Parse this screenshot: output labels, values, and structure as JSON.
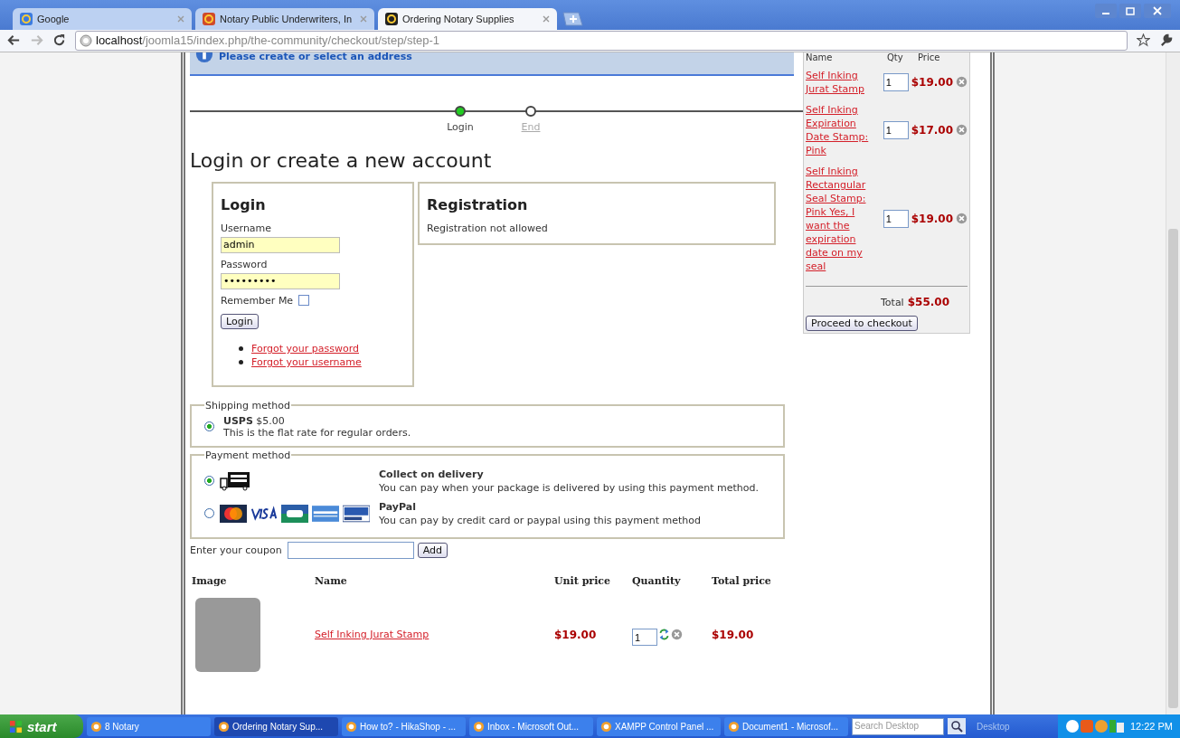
{
  "browser": {
    "tabs": [
      {
        "title": "Google",
        "selected": false,
        "kind": "google"
      },
      {
        "title": "Notary Public Underwriters, In",
        "selected": false,
        "kind": "joomla"
      },
      {
        "title": "Ordering Notary Supplies",
        "selected": true,
        "kind": "site"
      }
    ],
    "address": {
      "host": "localhost",
      "path": "/joomla15/index.php/the-community/checkout/step/step-1"
    }
  },
  "message": "Please create or select an address",
  "steps": [
    {
      "label": "Login",
      "selected": true
    },
    {
      "label": "End",
      "selected": false
    }
  ],
  "heading": "Login or create a new account",
  "login": {
    "title": "Login",
    "username_label": "Username",
    "username_value": "admin",
    "password_label": "Password",
    "password_value": "•••••••••",
    "remember_label": "Remember Me",
    "remember_checked": false,
    "button": "Login",
    "links": [
      "Forgot your password",
      "Forgot your username"
    ]
  },
  "registration": {
    "title": "Registration",
    "text": "Registration not allowed"
  },
  "shipping": {
    "legend": "Shipping method",
    "options": [
      {
        "name": "USPS",
        "price": "$5.00",
        "description": "This is the flat rate for regular orders.",
        "selected": true
      }
    ]
  },
  "payment": {
    "legend": "Payment method",
    "options": [
      {
        "kind": "delivery",
        "name": "Collect on delivery",
        "description": "You can pay when your package is delivered by using this payment method.",
        "selected": true
      },
      {
        "kind": "cards",
        "name": "PayPal",
        "description": "You can pay by credit card or paypal using this payment method",
        "selected": false
      }
    ]
  },
  "coupon": {
    "label": "Enter your coupon",
    "button": "Add"
  },
  "cart_table": {
    "columns": [
      "Image",
      "Name",
      "Unit price",
      "Quantity",
      "Total price"
    ],
    "rows": [
      {
        "name": "Self Inking Jurat Stamp",
        "unit_price": "$19.00",
        "quantity": "1",
        "total_price": "$19.00"
      }
    ]
  },
  "mini_cart": {
    "columns": [
      "Name",
      "Qty",
      "Price"
    ],
    "items": [
      {
        "name": "Self Inking Jurat Stamp",
        "quantity": "1",
        "price": "$19.00"
      },
      {
        "name": "Self Inking Expiration Date Stamp: Pink",
        "quantity": "1",
        "price": "$17.00"
      },
      {
        "name": "Self Inking Rectangular Seal Stamp: Pink Yes, I want the expiration date on my seal",
        "quantity": "1",
        "price": "$19.00"
      }
    ],
    "total_label": "Total",
    "total": "$55.00",
    "button": "Proceed to checkout"
  },
  "taskbar": {
    "start": "start",
    "tasks": [
      {
        "label": "8 Notary",
        "selected": false
      },
      {
        "label": "Ordering Notary Sup...",
        "selected": true
      },
      {
        "label": "How to? - HikaShop - ...",
        "selected": false
      },
      {
        "label": "Inbox - Microsoft Out...",
        "selected": false
      },
      {
        "label": "XAMPP Control Panel ...",
        "selected": false
      },
      {
        "label": "Document1 - Microsof...",
        "selected": false
      }
    ],
    "search_placeholder": "Search Desktop",
    "desktop": "Desktop",
    "time": "12:22 PM"
  }
}
